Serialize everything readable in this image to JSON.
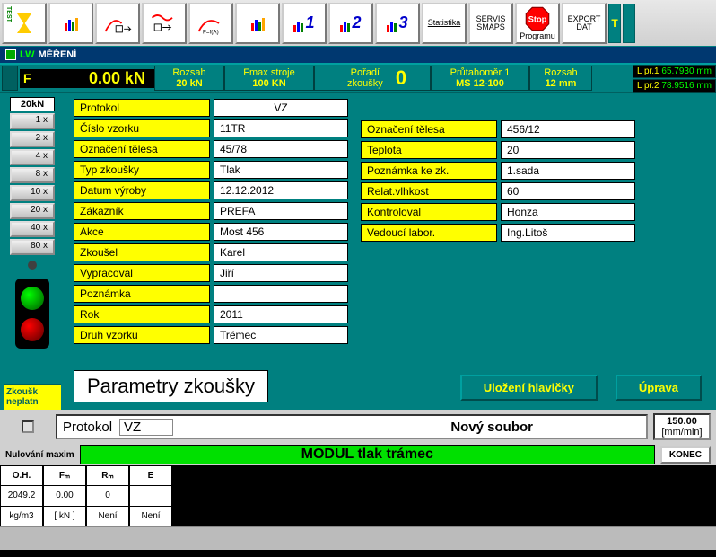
{
  "toolbar": {
    "items": [
      "TEST",
      "",
      "",
      "",
      "",
      "",
      "1",
      "2",
      "3",
      "Statistika",
      "SERVIS SMAPS",
      "Stop Programu",
      "EXPORT DAT"
    ],
    "indicator": "T"
  },
  "title": "MĚŘENÍ",
  "status": {
    "f_label": "F",
    "f_value": "0.00 kN",
    "rozsah_l": "Rozsah",
    "rozsah_v": "20 kN",
    "fmax_l": "Fmax  stroje",
    "fmax_v": "100 KN",
    "poradi_l": "Pořadí zkoušky",
    "poradi_v": "0",
    "prut_l": "Průtahoměr 1",
    "prut_v": "MS 12-100",
    "rozsah2_l": "Rozsah",
    "rozsah2_v": "12 mm",
    "lpr1_l": "L pr.1",
    "lpr1_v": "65.7930 mm",
    "lpr2_l": "L pr.2",
    "lpr2_v": "78.9516 mm"
  },
  "scale_top": "20kN",
  "mult": [
    "1 x",
    "2 x",
    "4 x",
    "8 x",
    "10 x",
    "20 x",
    "40 x",
    "80 x"
  ],
  "bottom_left": "Zkoušk neplatn",
  "form_left": [
    {
      "l": "Protokol",
      "v": "VZ"
    },
    {
      "l": "Číslo vzorku",
      "v": "11TR"
    },
    {
      "l": "Označení tělesa",
      "v": "45/78"
    },
    {
      "l": "Typ zkoušky",
      "v": "Tlak"
    },
    {
      "l": "Datum výroby",
      "v": "12.12.2012"
    },
    {
      "l": "Zákazník",
      "v": "PREFA"
    },
    {
      "l": "Akce",
      "v": "Most 456"
    },
    {
      "l": "Zkoušel",
      "v": "Karel"
    },
    {
      "l": "Vypracoval",
      "v": "Jiří"
    },
    {
      "l": "Poznámka",
      "v": ""
    },
    {
      "l": "Rok",
      "v": "2011"
    },
    {
      "l": "Druh vzorku",
      "v": "Trémec"
    }
  ],
  "form_right": [
    {
      "l": "Označení tělesa",
      "v": "456/12"
    },
    {
      "l": "Teplota",
      "v": "20"
    },
    {
      "l": "Poznámka ke zk.",
      "v": "1.sada"
    },
    {
      "l": "Relat.vlhkost",
      "v": "60"
    },
    {
      "l": "Kontroloval",
      "v": "Honza"
    },
    {
      "l": "Vedoucí labor.",
      "v": "Ing.Litoš"
    }
  ],
  "big_title": "Parametry zkoušky",
  "btn_save": "Uložení hlavičky",
  "btn_edit": "Úprava",
  "lower": {
    "proto_l": "Protokol",
    "proto_v": "VZ",
    "novy": "Nový soubor",
    "speed_v": "150.00",
    "speed_u": "[mm/min]"
  },
  "nulmax": "Nulování maxim",
  "greenbar": "MODUL tlak trámec",
  "konec": "KONEC",
  "data": {
    "h": [
      "O.H.",
      "Fₘ",
      "Rₘ",
      "E"
    ],
    "r1": [
      "2049.2",
      "0.00",
      "0",
      ""
    ],
    "r2": [
      "kg/m3",
      "[ kN ]",
      "Není",
      "Není"
    ]
  }
}
